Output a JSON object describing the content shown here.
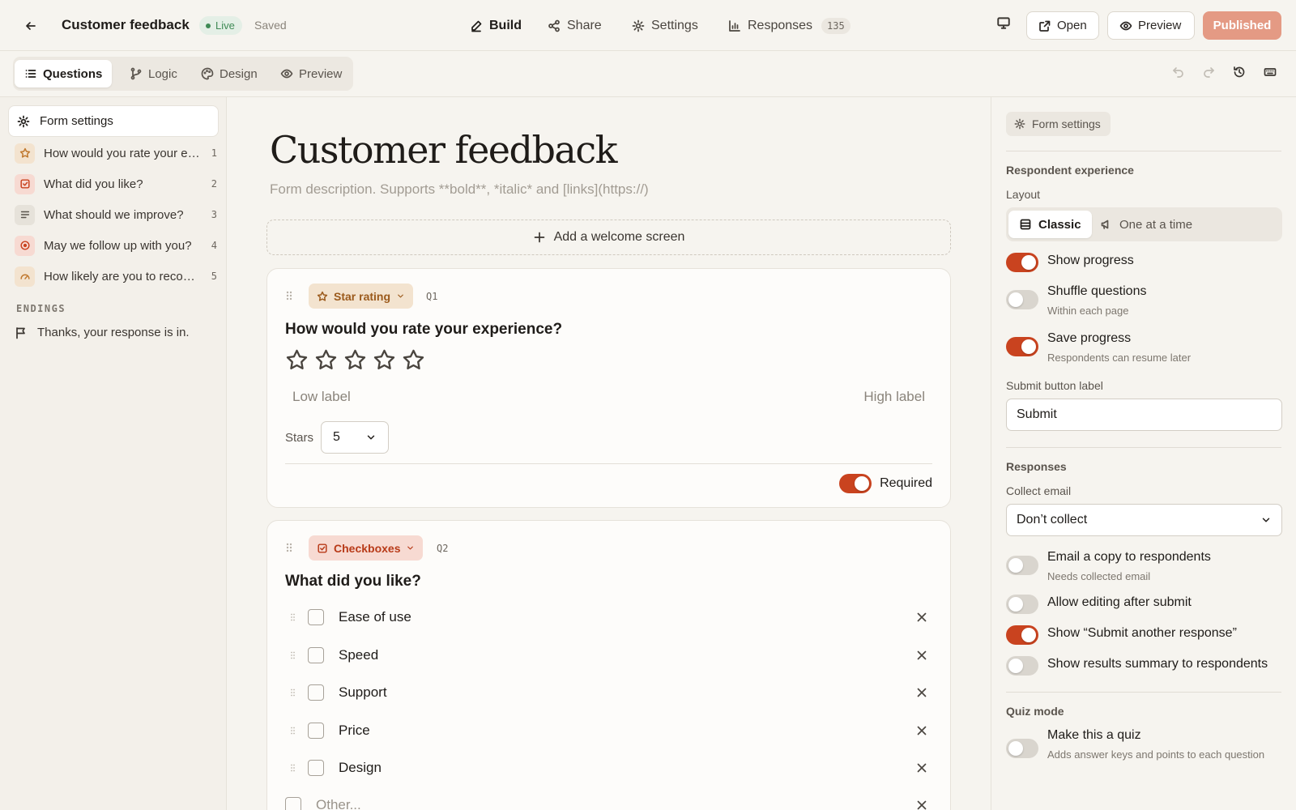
{
  "topbar": {
    "form_title": "Customer feedback",
    "status": "Live",
    "save_state": "Saved",
    "nav": [
      {
        "label": "Build",
        "icon": "pencil-icon",
        "active": true
      },
      {
        "label": "Share",
        "icon": "share-icon"
      },
      {
        "label": "Settings",
        "icon": "gear-icon"
      },
      {
        "label": "Responses",
        "icon": "bar-chart-icon",
        "count": "135"
      }
    ],
    "open_label": "Open",
    "preview_label": "Preview",
    "publish_label": "Published"
  },
  "subbar": {
    "tabs": [
      {
        "label": "Questions",
        "icon": "list-icon",
        "active": true
      },
      {
        "label": "Logic",
        "icon": "branch-icon"
      },
      {
        "label": "Design",
        "icon": "palette-icon"
      },
      {
        "label": "Preview",
        "icon": "eye-icon"
      }
    ]
  },
  "sidebar": {
    "settings_label": "Form settings",
    "questions": [
      {
        "label": "How would you rate your experience?",
        "number": "1",
        "icon": "star-icon",
        "color": "#f3e3cf"
      },
      {
        "label": "What did you like?",
        "number": "2",
        "icon": "checkbox-icon",
        "color": "#f7dad2"
      },
      {
        "label": "What should we improve?",
        "number": "3",
        "icon": "text-lines-icon",
        "color": "#e6e2da"
      },
      {
        "label": "May we follow up with you?",
        "number": "4",
        "icon": "radio-icon",
        "color": "#f7dad2"
      },
      {
        "label": "How likely are you to recommend us?",
        "number": "5",
        "icon": "gauge-icon",
        "color": "#f3e3cf"
      }
    ],
    "endings_heading": "ENDINGS",
    "ending_label": "Thanks, your response is in."
  },
  "canvas": {
    "title": "Customer feedback",
    "description_placeholder": "Form description. Supports **bold**, *italic* and [links](https://)",
    "welcome_label": "Add a welcome screen",
    "q1": {
      "type_label": "Star rating",
      "number": "Q1",
      "title": "How would you rate your experience?",
      "star_count": 5,
      "low_label": "Low label",
      "high_label": "High label",
      "stars_label": "Stars",
      "stars_value": "5",
      "required_label": "Required",
      "required": true
    },
    "q2": {
      "type_label": "Checkboxes",
      "number": "Q2",
      "title": "What did you like?",
      "options": [
        "Ease of use",
        "Speed",
        "Support",
        "Price",
        "Design"
      ],
      "other_placeholder": "Other..."
    }
  },
  "panel": {
    "chip_label": "Form settings",
    "respondent_heading": "Respondent experience",
    "layout_label": "Layout",
    "layout_classic": "Classic",
    "layout_one": "One at a time",
    "toggles_a": [
      {
        "label": "Show progress",
        "sub": "",
        "on": true
      },
      {
        "label": "Shuffle questions",
        "sub": "Within each page",
        "on": false
      },
      {
        "label": "Save progress",
        "sub": "Respondents can resume later",
        "on": true
      }
    ],
    "submit_label_title": "Submit button label",
    "submit_value": "Submit",
    "responses_heading": "Responses",
    "collect_email_label": "Collect email",
    "collect_email_value": "Don’t collect",
    "toggles_b": [
      {
        "label": "Email a copy to respondents",
        "sub": "Needs collected email",
        "on": false
      },
      {
        "label": "Allow editing after submit",
        "sub": "",
        "on": false
      },
      {
        "label": "Show “Submit another response”",
        "sub": "",
        "on": true
      },
      {
        "label": "Show results summary to respondents",
        "sub": "",
        "on": false
      }
    ],
    "quiz_heading": "Quiz mode",
    "quiz_toggle": {
      "label": "Make this a quiz",
      "sub": "Adds answer keys and points to each question",
      "on": false
    }
  },
  "colors": {
    "accent": "#c9431f",
    "live": "#3f8a55",
    "published_bg": "#e49a84"
  }
}
